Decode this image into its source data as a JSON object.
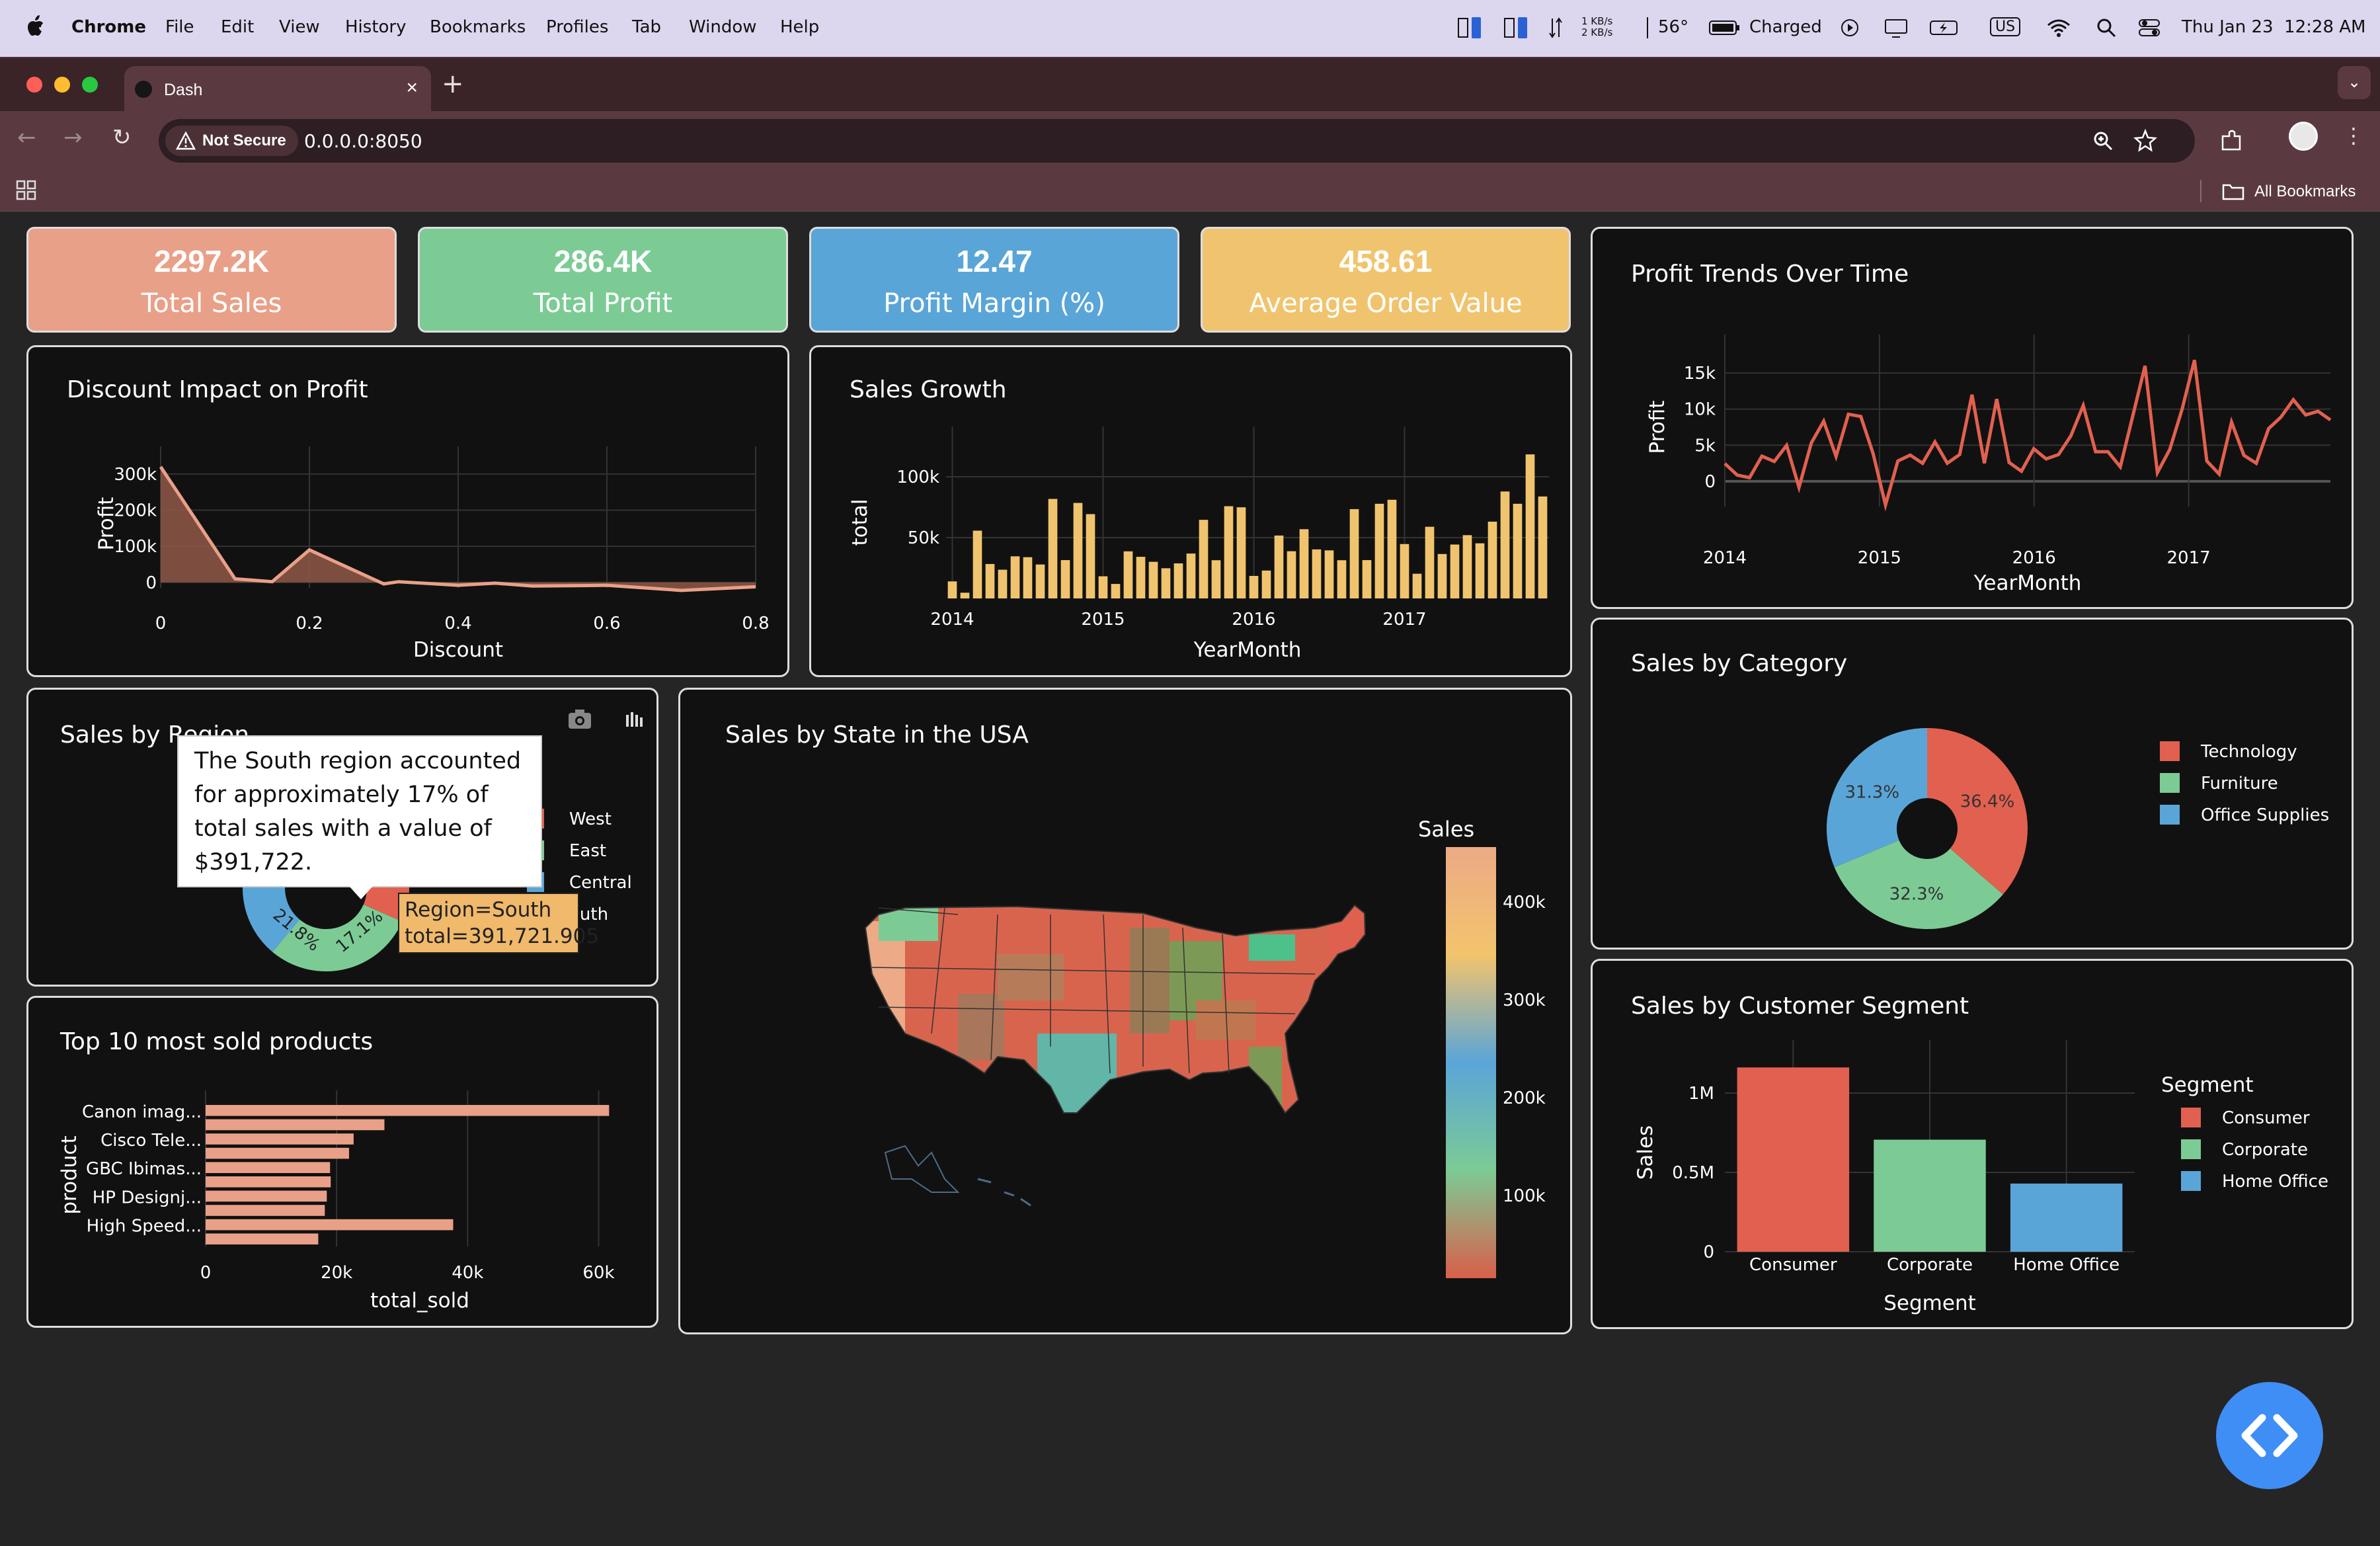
{
  "menubar": {
    "app": "Chrome",
    "items": [
      "File",
      "Edit",
      "View",
      "History",
      "Bookmarks",
      "Profiles",
      "Tab",
      "Window",
      "Help"
    ],
    "net_up": "1 KB/s",
    "net_down": "2 KB/s",
    "temperature": "56°",
    "battery": "Charged",
    "input": "US",
    "datetime": "Thu Jan 23  12:28 AM"
  },
  "browser": {
    "tab_title": "Dash",
    "security": "Not Secure",
    "url": "0.0.0.0:8050",
    "bookmarks_label": "All Bookmarks"
  },
  "kpis": [
    {
      "value": "2297.2K",
      "label": "Total Sales",
      "color": "#e9a088"
    },
    {
      "value": "286.4K",
      "label": "Total Profit",
      "color": "#7ccb95"
    },
    {
      "value": "12.47",
      "label": "Profit Margin (%)",
      "color": "#5aa5d8"
    },
    {
      "value": "458.61",
      "label": "Average Order Value",
      "color": "#f0c46e"
    }
  ],
  "charts": {
    "discount": {
      "title": "Discount Impact on Profit",
      "chart_data": {
        "type": "area",
        "xlabel": "Discount",
        "ylabel": "Profit",
        "xlim": [
          0,
          0.8
        ],
        "ylim": [
          -15000,
          340000
        ],
        "x_ticks": [
          "0",
          "0.2",
          "0.4",
          "0.6",
          "0.8"
        ],
        "y_ticks": [
          "0",
          "100k",
          "200k",
          "300k"
        ],
        "x": [
          0,
          0.1,
          0.15,
          0.2,
          0.3,
          0.32,
          0.4,
          0.45,
          0.5,
          0.6,
          0.7,
          0.8
        ],
        "y": [
          320000,
          10000,
          2000,
          90000,
          -4000,
          2000,
          -8000,
          -2000,
          -10000,
          -8000,
          -22000,
          -12000
        ],
        "color": "#e9a088"
      }
    },
    "growth": {
      "title": "Sales Growth",
      "chart_data": {
        "type": "bar",
        "xlabel": "YearMonth",
        "ylabel": "total",
        "ylim": [
          0,
          125000
        ],
        "x_ticks": [
          "2014",
          "2015",
          "2016",
          "2017"
        ],
        "y_ticks": [
          "50k",
          "100k"
        ],
        "x_tick_index": [
          0,
          12,
          24,
          36
        ],
        "values": [
          14000,
          4700,
          55700,
          28300,
          23600,
          34600,
          33900,
          27900,
          81800,
          31500,
          78500,
          69300,
          18200,
          11900,
          38700,
          34200,
          30100,
          24800,
          28800,
          36900,
          64600,
          31400,
          75800,
          74900,
          18500,
          22900,
          51700,
          38800,
          56900,
          40300,
          39500,
          31400,
          73400,
          31500,
          77800,
          81100,
          44700,
          20300,
          58900,
          36500,
          44300,
          52000,
          45300,
          63100,
          87900,
          77800,
          118400,
          83800
        ],
        "color": "#f0c46e"
      }
    },
    "profit_trend": {
      "title": "Profit Trends Over Time",
      "chart_data": {
        "type": "line",
        "xlabel": "YearMonth",
        "ylabel": "Profit",
        "ylim": [
          -3500,
          18500
        ],
        "x_ticks": [
          "2014",
          "2015",
          "2016",
          "2017"
        ],
        "y_ticks": [
          "0",
          "5k",
          "10k",
          "15k"
        ],
        "x_tick_index": [
          0,
          12,
          24,
          36
        ],
        "values": [
          2450,
          860,
          499,
          3488,
          2738,
          4976,
          -841,
          5318,
          8328,
          3448,
          9292,
          8984,
          3820,
          -3281,
          2814,
          3630,
          2500,
          5450,
          2500,
          3700,
          12000,
          2500,
          11400,
          2600,
          1400,
          4500,
          3100,
          3700,
          6300,
          10500,
          4100,
          4100,
          2000,
          9000,
          16000,
          1200,
          4400,
          10000,
          16800,
          2800,
          1000,
          8200,
          3600,
          2500,
          7300,
          8900,
          11300,
          9200,
          9700,
          8500
        ],
        "color": "#e2604f"
      }
    },
    "category": {
      "title": "Sales by Category",
      "chart_data": {
        "type": "pie",
        "categories": [
          "Technology",
          "Furniture",
          "Office Supplies"
        ],
        "values": [
          36.4,
          32.3,
          31.3
        ],
        "labels": [
          "36.4%",
          "32.3%",
          "31.3%"
        ],
        "colors": [
          "#e2604f",
          "#7ccb95",
          "#5aa5d8"
        ]
      }
    },
    "region": {
      "title": "Sales by Region",
      "chart_data": {
        "type": "pie",
        "categories": [
          "West",
          "East",
          "Central",
          "South"
        ],
        "values": [
          31.6,
          29.5,
          21.8,
          17.1
        ],
        "labels": [
          "21.8%",
          "17.1%"
        ],
        "colors": [
          "#e2604f",
          "#7ccb95",
          "#5aa5d8",
          "#f0b96b"
        ]
      },
      "legend": [
        "West",
        "East",
        "Central",
        "outh"
      ],
      "tooltip": "The South region accounted for approximately 17% of total sales with a value of $391,722.",
      "hover_line1": "Region=South",
      "hover_line2": "total=391,721.905"
    },
    "top_products": {
      "title": "Top 10 most sold products",
      "chart_data": {
        "type": "bar",
        "orientation": "horizontal",
        "xlabel": "total_sold",
        "ylabel": "product",
        "xlim": [
          0,
          65000
        ],
        "x_ticks": [
          "0",
          "20k",
          "40k",
          "60k"
        ],
        "categories": [
          "Canon imag...",
          "",
          "Cisco Tele...",
          "",
          "GBC Ibimas...",
          "",
          "HP Designj...",
          "",
          "High Speed...",
          ""
        ],
        "values": [
          61600,
          27300,
          22600,
          21900,
          19000,
          19100,
          18500,
          18200,
          37800,
          17200
        ],
        "color": "#e9a088"
      }
    },
    "segment": {
      "title": "Sales by Customer Segment",
      "chart_data": {
        "type": "bar",
        "xlabel": "Segment",
        "ylabel": "Sales",
        "ylim": [
          0,
          1250000
        ],
        "categories": [
          "Consumer",
          "Corporate",
          "Home Office"
        ],
        "y_ticks": [
          "0",
          "0.5M",
          "1M"
        ],
        "values": [
          1161401,
          706146,
          429653
        ],
        "colors": [
          "#e2604f",
          "#7ccb95",
          "#5aa5d8"
        ]
      },
      "legend_title": "Segment"
    },
    "map": {
      "title": "Sales by State in the USA",
      "colorbar_title": "Sales",
      "colorbar_ticks": [
        "400k",
        "300k",
        "200k",
        "100k"
      ]
    }
  }
}
